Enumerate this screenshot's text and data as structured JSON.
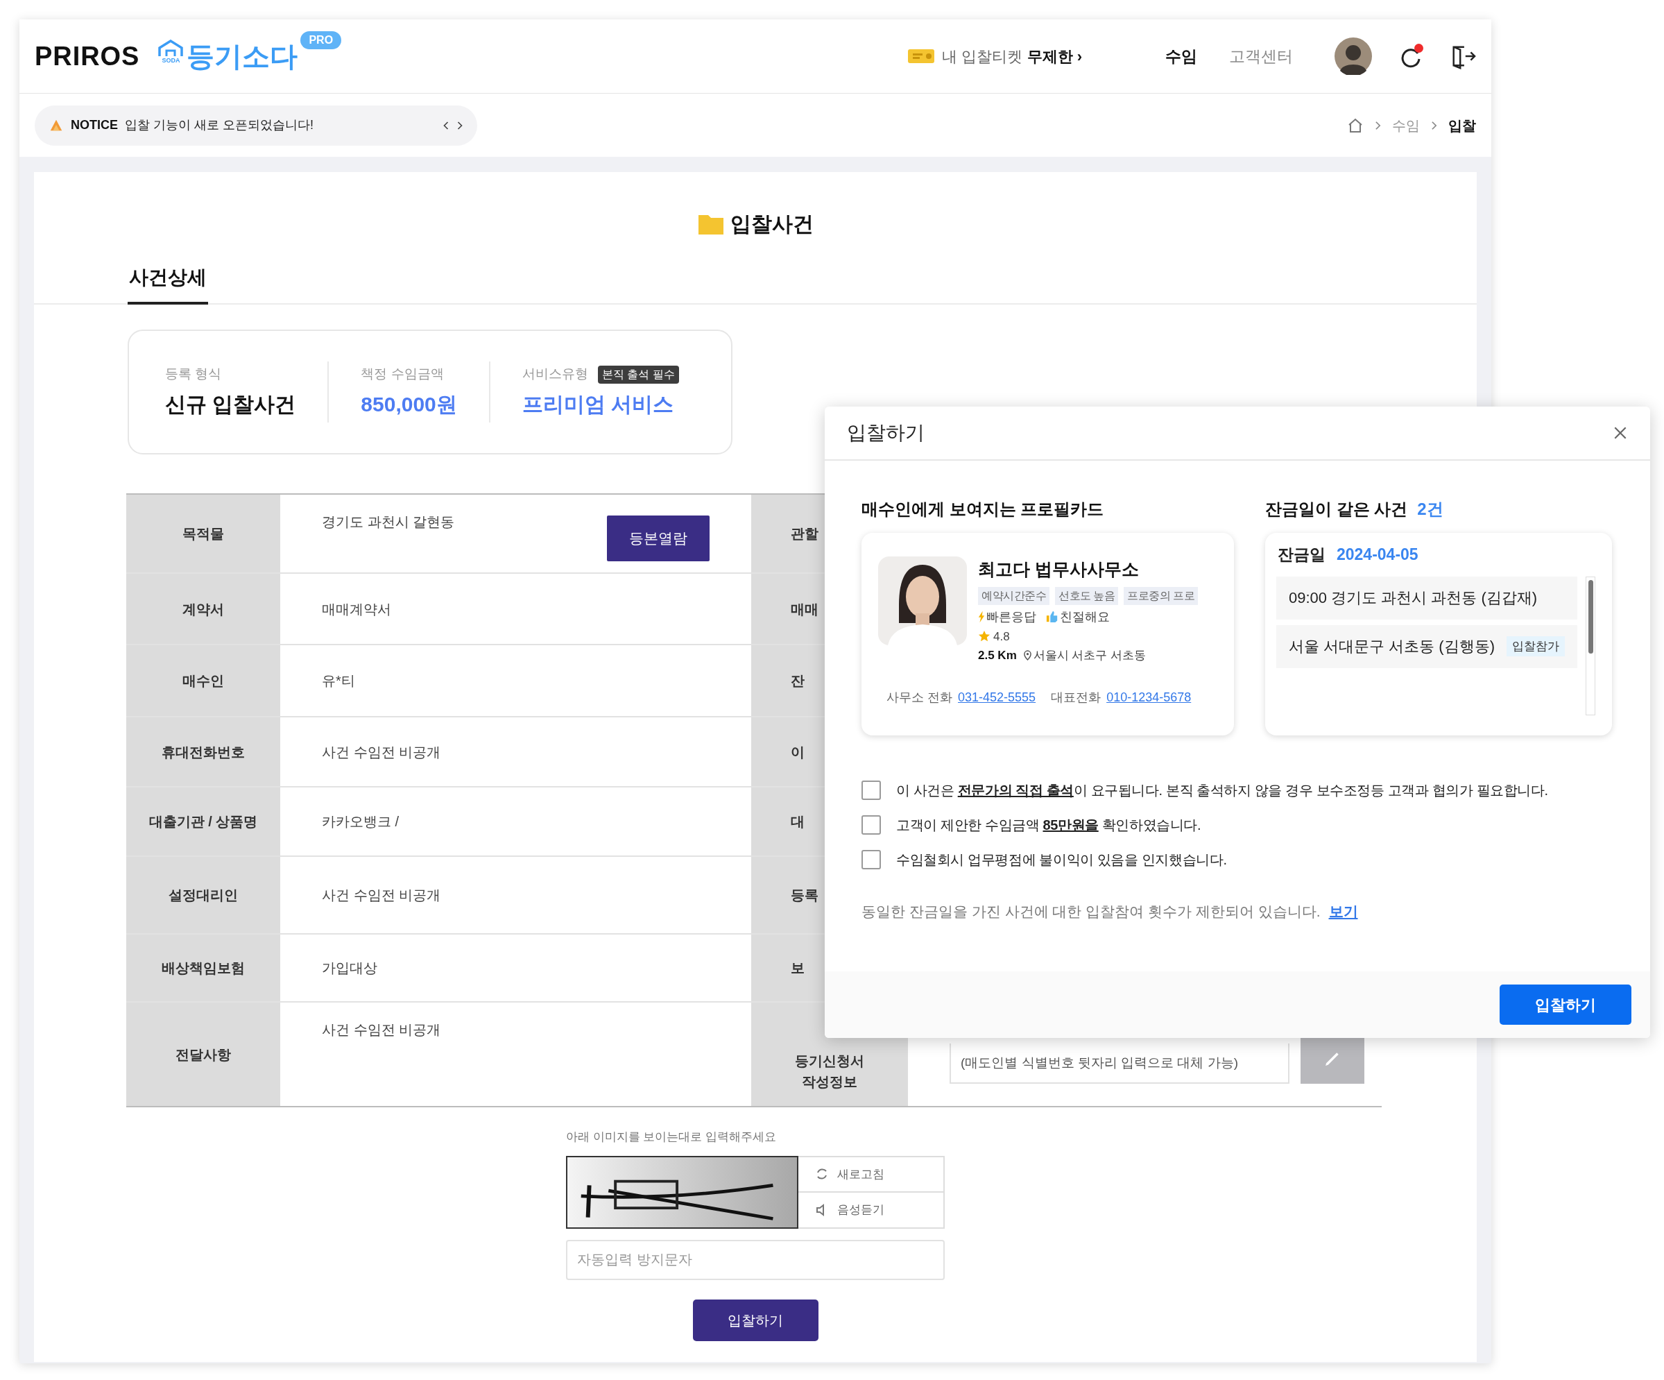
{
  "header": {
    "brand": "PRIROS",
    "logo_mark": "SODA",
    "logo_text": "등기소다",
    "badge": "PRO",
    "ticket": {
      "label": "내 입찰티켓",
      "value": "무제한 ›"
    },
    "nav": [
      {
        "label": "수임",
        "selected": true
      },
      {
        "label": "고객센터",
        "selected": false
      }
    ],
    "notification_unread": true
  },
  "notice": {
    "tag": "NOTICE",
    "text": "입찰 기능이 새로 오픈되었습니다!"
  },
  "breadcrumb": [
    "수임",
    "입찰"
  ],
  "page_title": "입찰사건",
  "tabs": [
    {
      "label": "사건상세",
      "selected": true
    }
  ],
  "summary": [
    {
      "label": "등록 형식",
      "value": "신규 입찰사건",
      "kind": "plain"
    },
    {
      "label": "책정 수임금액",
      "value": "850,000원",
      "kind": "accent"
    },
    {
      "label": "서비스유형",
      "badge": "본직 출석 필수",
      "value": "프리미엄 서비스",
      "kind": "accent"
    }
  ],
  "table": {
    "rows": [
      {
        "label": "목적물",
        "value": "경기도 과천시 갈현동",
        "action": "등본열람",
        "side_label": "관할"
      },
      {
        "label": "계약서",
        "value": "매매계약서",
        "side_label": "매매"
      },
      {
        "label": "매수인",
        "value": "유*티",
        "side_label": "잔"
      },
      {
        "label": "휴대전화번호",
        "value": "사건 수임전 비공개",
        "side_label": "이"
      },
      {
        "label": "대출기관 / 상품명",
        "value": "카카오뱅크 /",
        "side_label": "대"
      },
      {
        "label": "설정대리인",
        "value": "사건 수임전 비공개",
        "side_label": "등록"
      },
      {
        "label": "배상책임보험",
        "value": "가입대상",
        "side_label": "보"
      },
      {
        "label": "전달사항",
        "value": "사건 수임전 비공개",
        "side_label": "등기신청서 작성정보",
        "side_value": "(매도인별 식별번호 뒷자리 입력으로 대체 가능)"
      }
    ]
  },
  "captcha": {
    "instruction": "아래 이미지를 보이는대로 입력해주세요",
    "refresh": "새로고침",
    "audio": "음성듣기",
    "placeholder": "자동입력 방지문자"
  },
  "submit": "입찰하기",
  "modal": {
    "title": "입찰하기",
    "profile_heading": "매수인에게 보여지는 프로필카드",
    "profile": {
      "name": "최고다 법무사사무소",
      "tags": [
        "예약시간준수",
        "선호도 높음",
        "프로중의 프로"
      ],
      "traits": [
        {
          "kind": "fast",
          "label": "빠른응답"
        },
        {
          "kind": "kind",
          "label": "친절해요"
        }
      ],
      "rating": "4.8",
      "distance": "2.5 Km",
      "location": "서울시 서초구 서초동",
      "office_phone_label": "사무소 전화",
      "office_phone": "031-452-5555",
      "main_phone_label": "대표전화",
      "main_phone": "010-1234-5678"
    },
    "same_date_heading": "잔금일이 같은 사건",
    "same_date_count": "2건",
    "settle_label": "잔금일",
    "settle_date": "2024-04-05",
    "cases": [
      {
        "text": "09:00 경기도 과천시 과천동 (김갑재)"
      },
      {
        "text": "서울 서대문구 서초동 (김행동)",
        "badge": "입찰참가"
      }
    ],
    "agreements": [
      {
        "text": "이 사건은 **전문가의 직접 출석**이 요구됩니다. 본직 출석하지 않을 경우 보수조정등 고객과 협의가 필요합니다.",
        "checked": false
      },
      {
        "text": "고객이 제안한 수임금액 **85만원을** 확인하였습니다.",
        "checked": false
      },
      {
        "text": "수임철회시 업무평점에 불이익이 있음을 인지했습니다.",
        "checked": false
      }
    ],
    "limit_note": "동일한 잔금일을 가진 사건에 대한 입찰참여 횟수가 제한되어 있습니다.",
    "limit_link": "보기",
    "submit": "입찰하기"
  }
}
